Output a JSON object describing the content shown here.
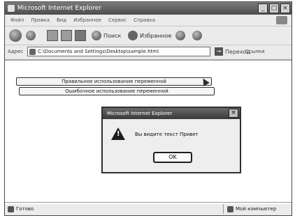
{
  "window": {
    "title": "Microsoft Internet Explorer"
  },
  "menu": [
    "Файл",
    "Правка",
    "Вид",
    "Избранное",
    "Сервис",
    "Справка"
  ],
  "toolbar": {
    "search_label": "Поиск",
    "favorites_label": "Избранное"
  },
  "address": {
    "label": "Адрес",
    "url": "C:\\Documents and Settings\\Desktop\\sample.html",
    "go_label": "Переход",
    "links_label": "Ссылки"
  },
  "page": {
    "button1_label": "Правильное использование переменной",
    "button2_label": "Ошибочное использование переменной"
  },
  "dialog": {
    "title": "Microsoft Internet Explorer",
    "message": "Вы видите текст Привет",
    "ok_label": "OK"
  },
  "status": {
    "left": "Готово",
    "right": "Мой компьютер"
  }
}
